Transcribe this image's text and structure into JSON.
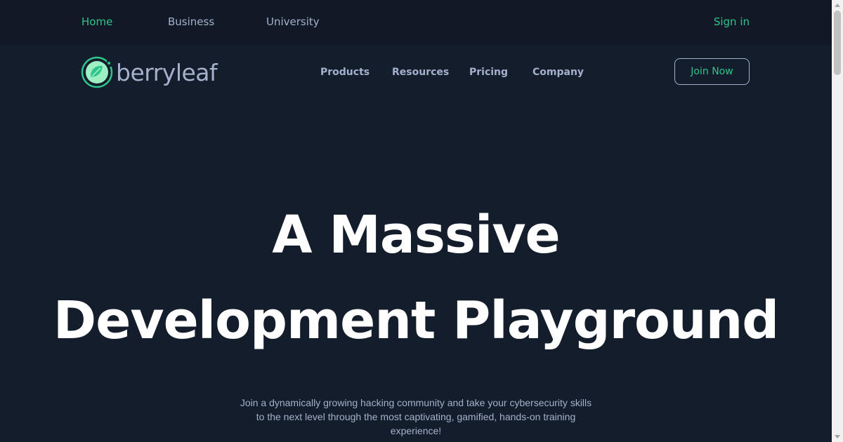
{
  "topbar": {
    "home": "Home",
    "business": "Business",
    "university": "University",
    "signin": "Sign in"
  },
  "brand": {
    "name": "berryleaf",
    "logo_icon": "leaf-icon"
  },
  "nav": {
    "items": [
      {
        "label": "Products"
      },
      {
        "label": "Resources"
      },
      {
        "label": "Pricing"
      },
      {
        "label": "Company"
      }
    ],
    "join_label": "Join Now"
  },
  "hero": {
    "title_line1": "A Massive",
    "title_line2": "Development Playground",
    "subtitle": "Join a dynamically growing hacking community and take your cybersecurity skills to the next level through the most captivating, gamified, hands-on training experience!"
  },
  "colors": {
    "background": "#141d2b",
    "topbar": "#111927",
    "accent": "#2ec58c",
    "muted_text": "#a4b1cd",
    "heading": "#ffffff"
  }
}
